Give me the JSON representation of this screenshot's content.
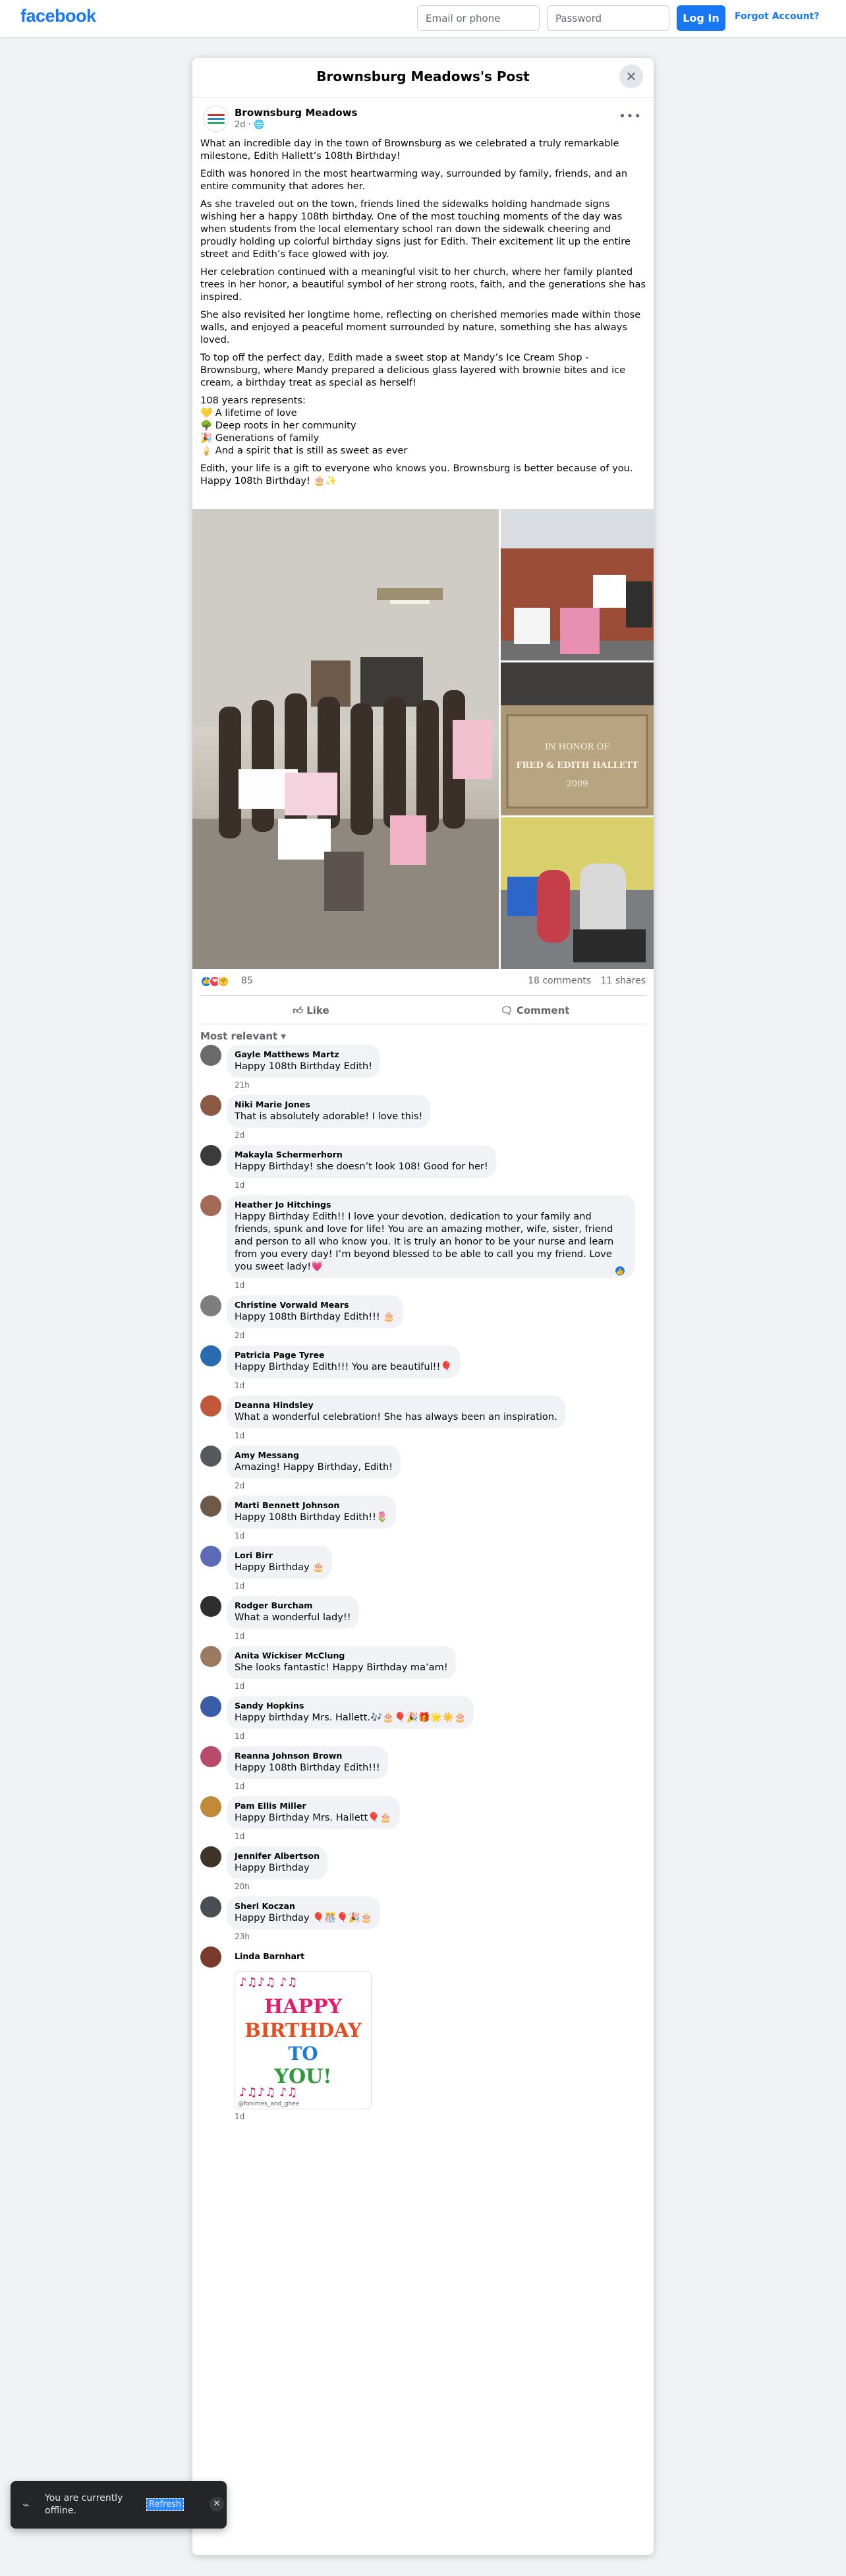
{
  "topbar": {
    "logo": "facebook",
    "email_placeholder": "Email or phone",
    "password_placeholder": "Password",
    "login_label": "Log In",
    "forgot_label": "Forgot Account?"
  },
  "dialog": {
    "title": "Brownsburg Meadows's Post",
    "close_icon": "close-icon"
  },
  "post": {
    "author": "Brownsburg Meadows",
    "time": "2d",
    "audience_icon": "globe-icon",
    "paragraphs": [
      "What an incredible day in the town of Brownsburg as we celebrated a truly remarkable milestone, Edith Hallett’s 108th Birthday!",
      "Edith was honored in the most heartwarming way, surrounded by family, friends, and an entire community that adores her.",
      "As she traveled out on the town, friends lined the sidewalks holding handmade signs wishing her a happy 108th birthday. One of the most touching moments of the day was when students from the local elementary school ran down the sidewalk cheering and proudly holding up colorful birthday signs just for Edith. Their excitement lit up the entire street and Edith’s face glowed with joy.",
      "Her celebration continued with a meaningful visit to her church, where her family planted trees in her honor, a beautiful symbol of her strong roots, faith, and the generations she has inspired.",
      "She also revisited her longtime home, reflecting on cherished memories made within those walls, and enjoyed a peaceful moment surrounded by nature, something she has always loved.",
      "To top off the perfect day, Edith made a sweet stop at Mandy’s Ice Cream Shop - Brownsburg, where Mandy prepared a delicious glass layered with brownie bites and ice cream, a birthday treat as special as herself!"
    ],
    "list_intro": "108 years represents:",
    "list": [
      "💛 A lifetime of love",
      "🌳 Deep roots in her community",
      "🎉 Generations of family",
      "🍦 And a spirit that is still as sweet as ever"
    ],
    "closing": "Edith, your life is a gift to everyone who knows you. Brownsburg is better because of you. Happy 108th Birthday! 🎂✨",
    "photo_sign_text": "IN HONOR OF FRED & EDITH HALLETT 2009",
    "reaction_count": "85",
    "comments_count": "18 comments",
    "shares_count": "11 shares",
    "like_label": "Like",
    "comment_label": "Comment",
    "sort_label": "Most relevant"
  },
  "comments": [
    {
      "name": "Gayle Matthews Martz",
      "text": "Happy 108th Birthday Edith!",
      "time": "21h",
      "color": "#6b6b6b"
    },
    {
      "name": "Niki Marie Jones",
      "text": "That is absolutely adorable! I love this!",
      "time": "2d",
      "color": "#8a5a44"
    },
    {
      "name": "Makayla Schermerhorn",
      "text": "Happy Birthday! she doesn’t look 108! Good for her!",
      "time": "1d",
      "color": "#3b3b3b"
    },
    {
      "name": "Heather Jo Hitchings",
      "text": "Happy Birthday Edith!! I love your devotion, dedication to your family and friends, spunk and love for life! You are an amazing mother, wife, sister, friend and person to all who know you. It is truly an honor to be your nurse and learn from you every day! I’m beyond blessed to be able to call you my friend. Love you sweet lady!💗",
      "time": "1d",
      "color": "#a36b57"
    },
    {
      "name": "Christine Vorwald Mears",
      "text": "Happy 108th Birthday Edith!!! 🎂",
      "time": "2d",
      "color": "#7d7d7d"
    },
    {
      "name": "Patricia Page Tyree",
      "text": "Happy Birthday Edith!!! You are beautiful!!🎈",
      "time": "1d",
      "color": "#2a6bb0"
    },
    {
      "name": "Deanna Hindsley",
      "text": "What a wonderful celebration! She has always been an inspiration.",
      "time": "1d",
      "color": "#c0573a"
    },
    {
      "name": "Amy Messang",
      "text": "Amazing! Happy Birthday, Edith!",
      "time": "2d",
      "color": "#55585c"
    },
    {
      "name": "Marti Bennett Johnson",
      "text": "Happy 108th Birthday Edith!!🌷",
      "time": "1d",
      "color": "#6f5a4a"
    },
    {
      "name": "Lori Birr",
      "text": "Happy Birthday 🎂",
      "time": "1d",
      "color": "#5b6bb8"
    },
    {
      "name": "Rodger Burcham",
      "text": "What a wonderful lady!!",
      "time": "1d",
      "color": "#2e2e2e"
    },
    {
      "name": "Anita Wickiser McClung",
      "text": "She looks fantastic! Happy Birthday ma’am!",
      "time": "1d",
      "color": "#9a7b62"
    },
    {
      "name": "Sandy Hopkins",
      "text": "Happy birthday Mrs. Hallett.🎶🎂🎈🎉🎁🌟☀️🎂",
      "time": "1d",
      "color": "#3a5da8"
    },
    {
      "name": "Reanna Johnson Brown",
      "text": "Happy 108th Birthday Edith!!!",
      "time": "1d",
      "color": "#b84a6a"
    },
    {
      "name": "Pam Ellis Miller",
      "text": "Happy Birthday Mrs. Hallett🎈🎂",
      "time": "1d",
      "color": "#c08a3a"
    },
    {
      "name": "Jennifer Albertson",
      "text": "Happy Birthday",
      "time": "20h",
      "color": "#3f3226"
    },
    {
      "name": "Sheri Koczan",
      "text": "Happy Birthday 🎈🎊🎈🎉🎂",
      "time": "23h",
      "color": "#4a4f55"
    },
    {
      "name": "Linda Barnhart",
      "text": "",
      "time": "1d",
      "color": "#7a3b2a"
    }
  ],
  "gif": {
    "line1": "HAPPY",
    "line2": "BIRTHDAY",
    "line3": "TO",
    "line4": "YOU!",
    "notes_top": "♪♫♪♫ ♪♫",
    "notes_bottom": "♪♫♪♫ ♪♫",
    "credit": "@fonimes_and_ghee"
  },
  "toast": {
    "text": "You are currently offline.",
    "refresh_label": "Refresh",
    "icon": "wifi-off-icon",
    "close_icon": "close-icon"
  },
  "colors": {
    "brand": "#1877f2",
    "page_bg": "#f0f2f5",
    "bubble": "#f0f2f5"
  }
}
